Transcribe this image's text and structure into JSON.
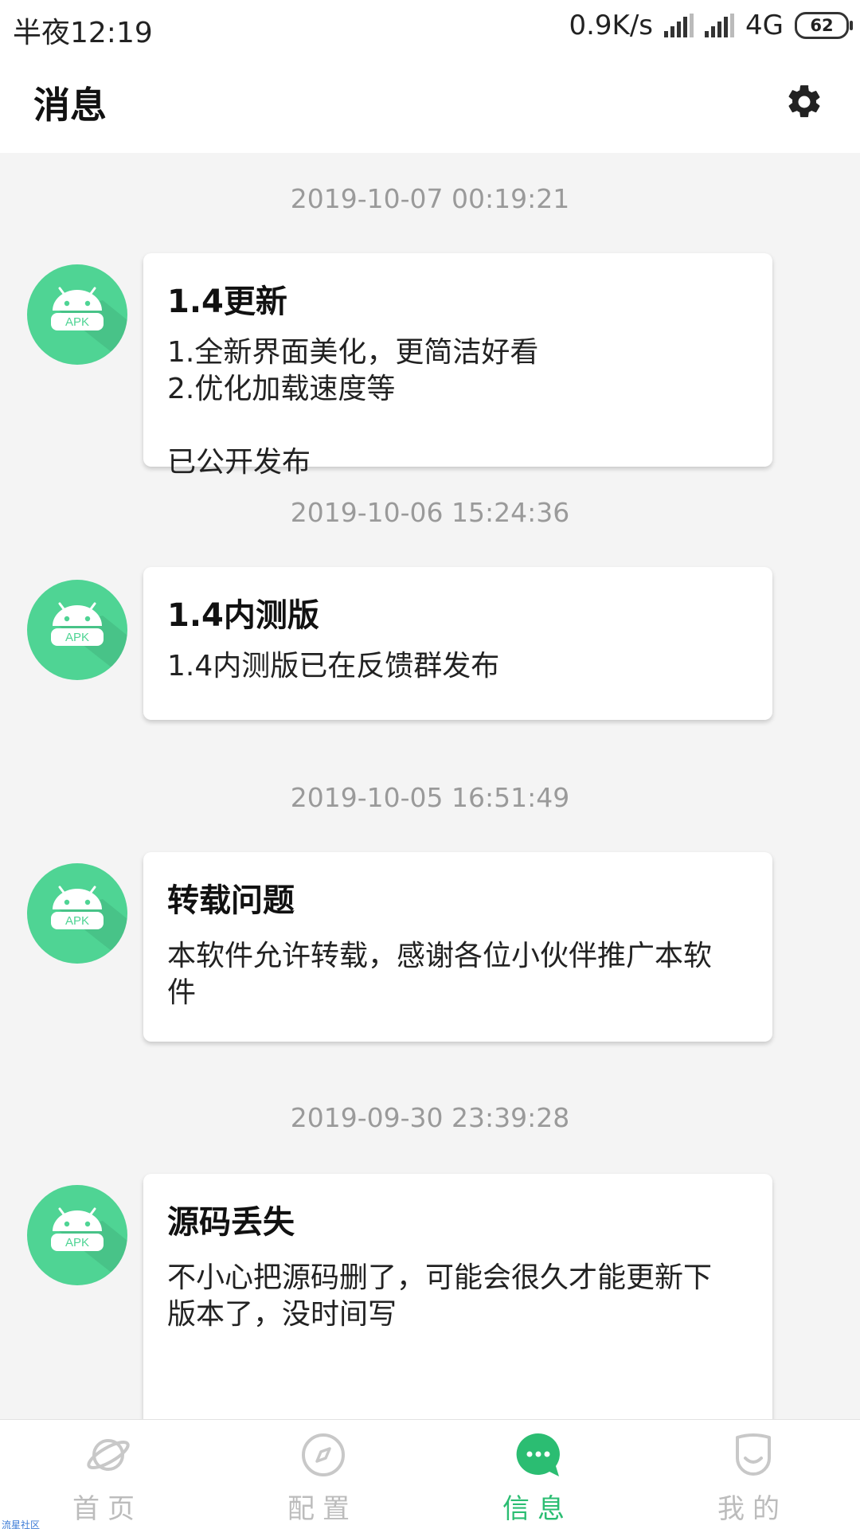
{
  "status_bar": {
    "time": "半夜12:19",
    "net_speed": "0.9K/s",
    "network": "4G",
    "battery": "62"
  },
  "header": {
    "title": "消息",
    "settings_icon": "gear-icon"
  },
  "messages": [
    {
      "timestamp": "2019-10-07 00:19:21",
      "avatar_text": "APK",
      "title": "1.4更新",
      "body": "1.全新界面美化，更简洁好看\n2.优化加载速度等\n\n已公开发布"
    },
    {
      "timestamp": "2019-10-06 15:24:36",
      "avatar_text": "APK",
      "title": "1.4内测版",
      "body": "1.4内测版已在反馈群发布"
    },
    {
      "timestamp": "2019-10-05 16:51:49",
      "avatar_text": "APK",
      "title": "转载问题",
      "body": "本软件允许转载，感谢各位小伙伴推广本软\n件"
    },
    {
      "timestamp": "2019-09-30 23:39:28",
      "avatar_text": "APK",
      "title": "源码丢失",
      "body": "不小心把源码删了，可能会很久才能更新下\n版本了，没时间写"
    }
  ],
  "bottom_nav": {
    "items": [
      {
        "label": "首页",
        "icon": "planet-icon",
        "active": false
      },
      {
        "label": "配置",
        "icon": "compass-icon",
        "active": false
      },
      {
        "label": "信息",
        "icon": "chat-bubble-icon",
        "active": true
      },
      {
        "label": "我的",
        "icon": "smile-icon",
        "active": false
      }
    ]
  },
  "colors": {
    "accent": "#2bbd72",
    "avatar_green": "#4fd494",
    "inactive": "#bcbcbc",
    "timestamp": "#9a9a9a"
  },
  "watermark": "流星社区"
}
